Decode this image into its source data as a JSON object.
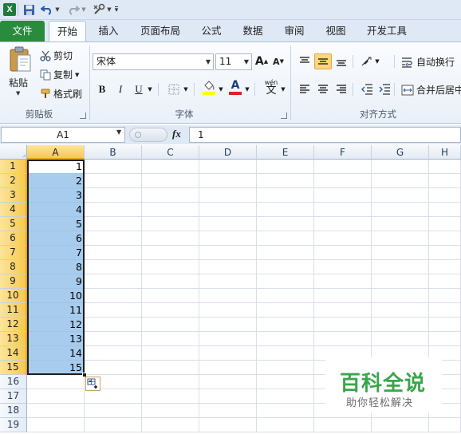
{
  "colors": {
    "file_tab": "#2a8a3e",
    "selection_fill": "#a8ccee",
    "header_highlight": "#f6c94f",
    "watermark_green": "#3aa64a"
  },
  "qat": {
    "icons": [
      "excel-logo-icon",
      "save-icon",
      "undo-icon",
      "redo-icon",
      "tools-icon",
      "customize-qat-icon"
    ],
    "logo_letter": "X"
  },
  "tabs": [
    "文件",
    "开始",
    "插入",
    "页面布局",
    "公式",
    "数据",
    "审阅",
    "视图",
    "开发工具"
  ],
  "ribbon": {
    "clipboard": {
      "paste": "粘贴",
      "cut": "剪切",
      "copy": "复制",
      "format_painter": "格式刷",
      "group_label": "剪贴板"
    },
    "font": {
      "font_name": "宋体",
      "font_size": "11",
      "bold": "B",
      "italic": "I",
      "underline": "U",
      "grow": "A",
      "shrink": "A",
      "font_color": "A",
      "phonetic": "wén",
      "group_label": "字体"
    },
    "alignment": {
      "wrap_text": "自动换行",
      "merge_center": "合并后居中",
      "group_label": "对齐方式"
    }
  },
  "formula_bar": {
    "name_box": "A1",
    "fx": "fx",
    "value": "1"
  },
  "sheet": {
    "columns": [
      "A",
      "B",
      "C",
      "D",
      "E",
      "F",
      "G",
      "H"
    ],
    "rows": [
      "1",
      "2",
      "3",
      "4",
      "5",
      "6",
      "7",
      "8",
      "9",
      "10",
      "11",
      "12",
      "13",
      "14",
      "15",
      "16",
      "17",
      "18",
      "19"
    ],
    "column_a_values": [
      "1",
      "2",
      "3",
      "4",
      "5",
      "6",
      "7",
      "8",
      "9",
      "10",
      "11",
      "12",
      "13",
      "14",
      "15"
    ]
  },
  "watermark": {
    "title": "百科全说",
    "subtitle": "助你轻松解决"
  }
}
